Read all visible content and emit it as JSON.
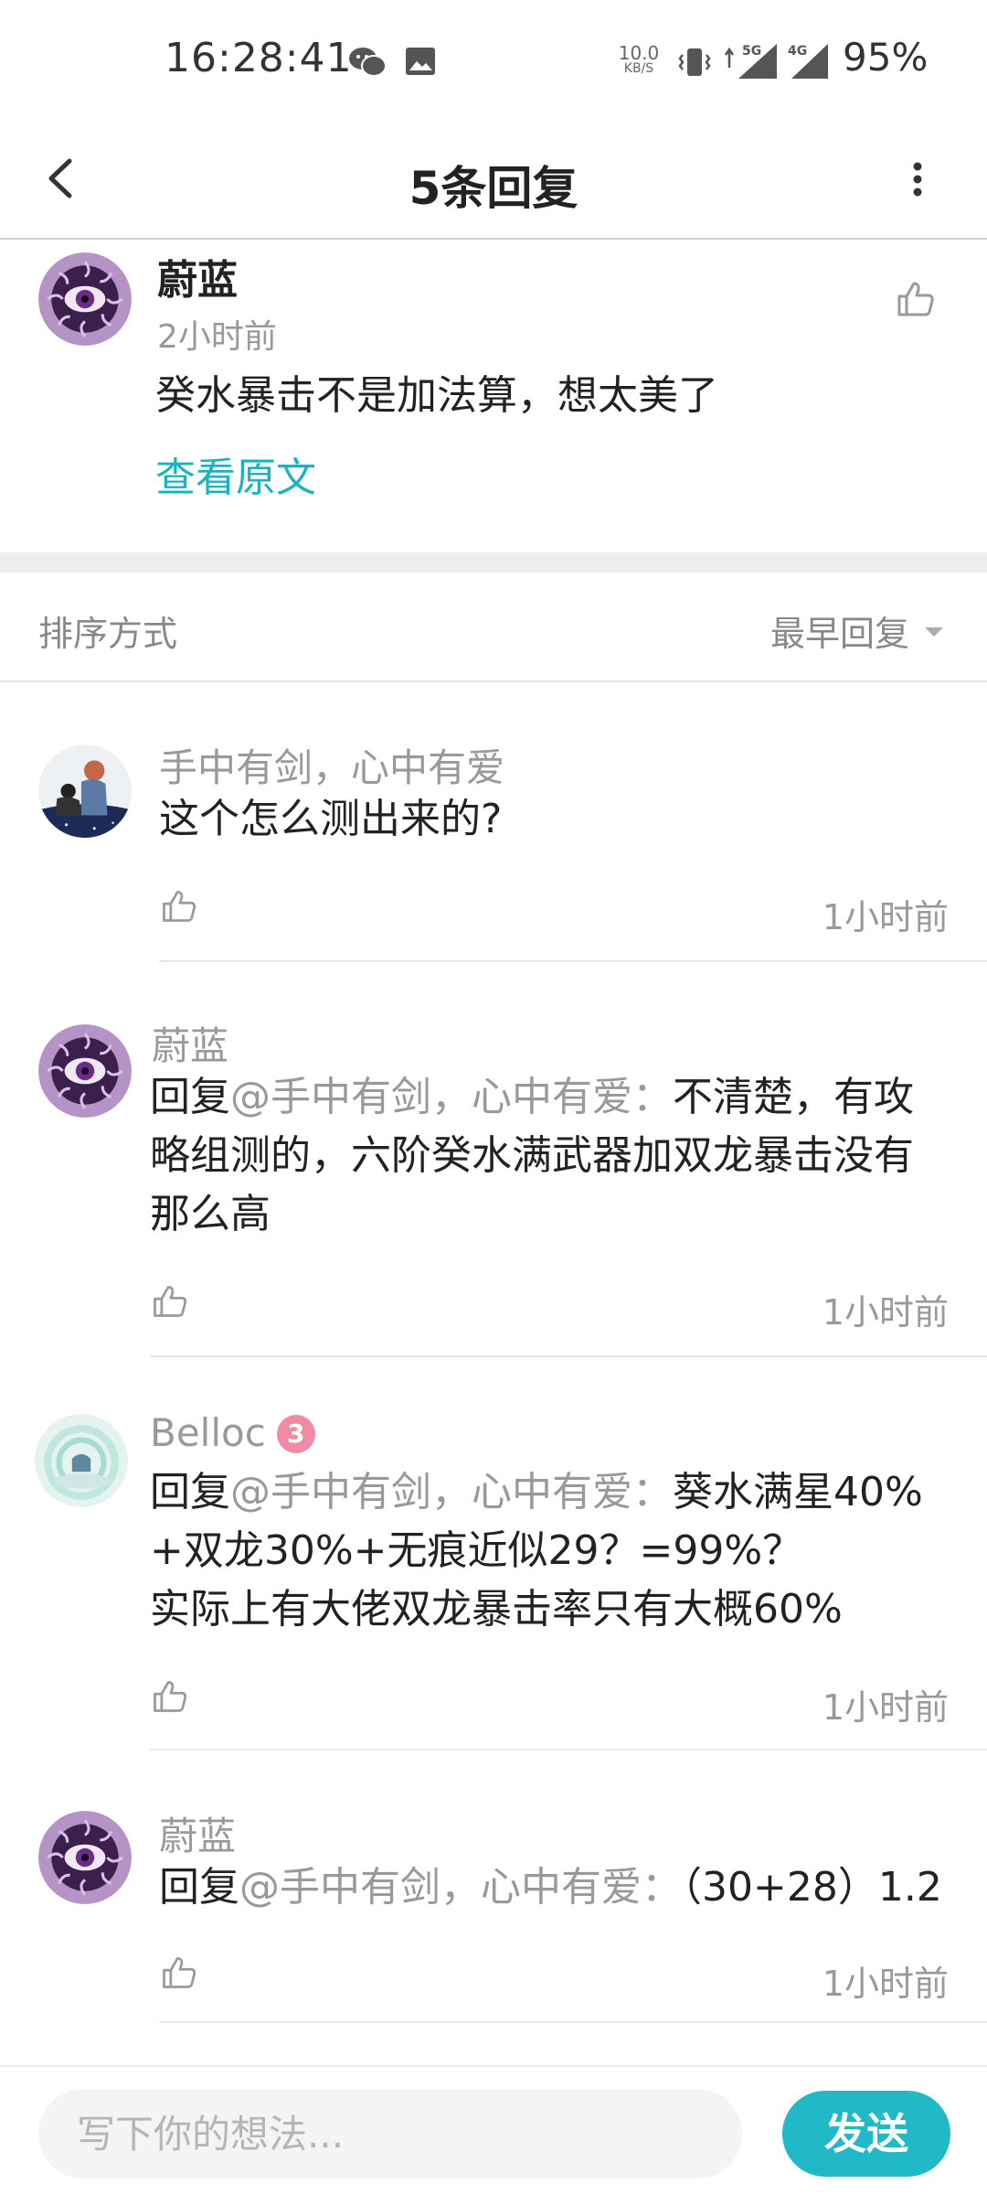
{
  "status_bar": {
    "time": "16:28:41",
    "net_speed_value": "10.0",
    "net_speed_unit": "KB/S",
    "sig1_label": "5G",
    "sig2_label": "4G",
    "battery": "95%",
    "icons": [
      "wechat-icon",
      "image-icon",
      "vibrate-icon",
      "signal-5g-icon",
      "signal-4g-icon"
    ]
  },
  "header": {
    "title": "5条回复"
  },
  "main_comment": {
    "author": "蔚蓝",
    "time": "2小时前",
    "text": "癸水暴击不是加法算，想太美了",
    "view_original": "查看原文"
  },
  "sort": {
    "label": "排序方式",
    "value": "最早回复"
  },
  "replies": [
    {
      "author": "手中有剑，心中有爱",
      "text": "这个怎么测出来的?",
      "time": "1小时前"
    },
    {
      "author": "蔚蓝",
      "prefix": "回复",
      "mention": "@手中有剑，心中有爱：",
      "text": "不清楚，有攻\n略组测的，六阶癸水满武器加双龙暴击没有\n那么高",
      "time": "1小时前"
    },
    {
      "author": "Belloc",
      "badge": "3",
      "prefix": "回复",
      "mention": "@手中有剑，心中有爱：",
      "text": "葵水满星40%\n+双龙30%+无痕近似29？=99%？\n实际上有大佬双龙暴击率只有大概60%",
      "time": "1小时前"
    },
    {
      "author": "蔚蓝",
      "prefix": "回复",
      "mention": "@手中有剑，心中有爱：",
      "text": "（30+28）1.2",
      "time": "1小时前"
    }
  ],
  "bottom_bar": {
    "placeholder": "写下你的想法...",
    "send_label": "发送"
  },
  "colors": {
    "accent": "#20b9c5",
    "link": "#1cb3c0",
    "muted": "#999999"
  }
}
